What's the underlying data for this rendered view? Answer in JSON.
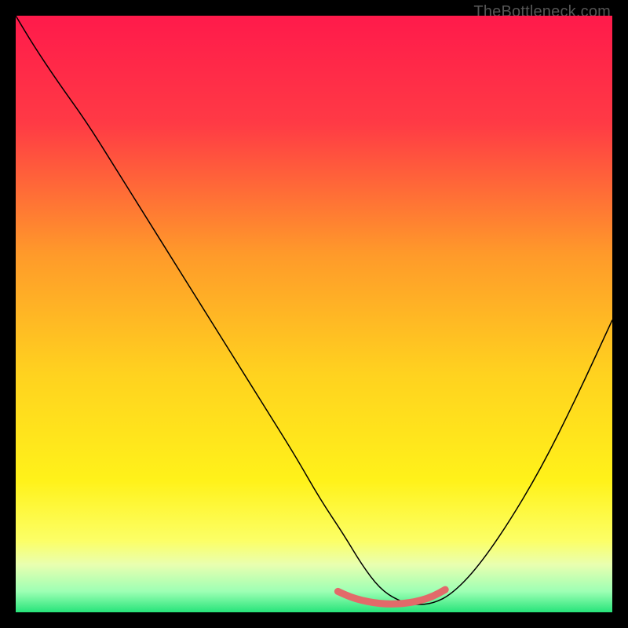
{
  "watermark": "TheBottleneck.com",
  "chart_data": {
    "type": "line",
    "title": "",
    "xlabel": "",
    "ylabel": "",
    "xlim": [
      0,
      100
    ],
    "ylim": [
      0,
      100
    ],
    "grid": false,
    "legend": false,
    "gradient_stops": [
      {
        "pos": 0.0,
        "color": "#ff1a4b"
      },
      {
        "pos": 0.18,
        "color": "#ff3a45"
      },
      {
        "pos": 0.4,
        "color": "#ff9a2a"
      },
      {
        "pos": 0.6,
        "color": "#ffd21f"
      },
      {
        "pos": 0.78,
        "color": "#fff21a"
      },
      {
        "pos": 0.88,
        "color": "#fcff66"
      },
      {
        "pos": 0.92,
        "color": "#e9ffb0"
      },
      {
        "pos": 0.965,
        "color": "#9dffb4"
      },
      {
        "pos": 1.0,
        "color": "#27e47a"
      }
    ],
    "series": [
      {
        "name": "bottleneck-curve",
        "color": "#000000",
        "stroke_width": 1.5,
        "x": [
          0,
          3,
          7,
          12,
          17,
          22,
          27,
          32,
          37,
          42,
          47,
          51,
          55,
          58,
          61,
          64,
          67,
          70,
          73,
          77,
          82,
          88,
          94,
          100
        ],
        "values": [
          100,
          95,
          89,
          82,
          74,
          66,
          58,
          50,
          42,
          34,
          26,
          19,
          13,
          8,
          4,
          2,
          1.2,
          1.5,
          3,
          7,
          14,
          24,
          36,
          49
        ]
      },
      {
        "name": "highlight-band",
        "color": "#e26a6a",
        "stroke_width": 9,
        "linecap": "round",
        "x": [
          54,
          56,
          58,
          60,
          62,
          64,
          66,
          68,
          70,
          72
        ],
        "values": [
          3.5,
          2.6,
          2.0,
          1.6,
          1.4,
          1.4,
          1.6,
          2.0,
          2.7,
          3.8
        ]
      }
    ]
  }
}
